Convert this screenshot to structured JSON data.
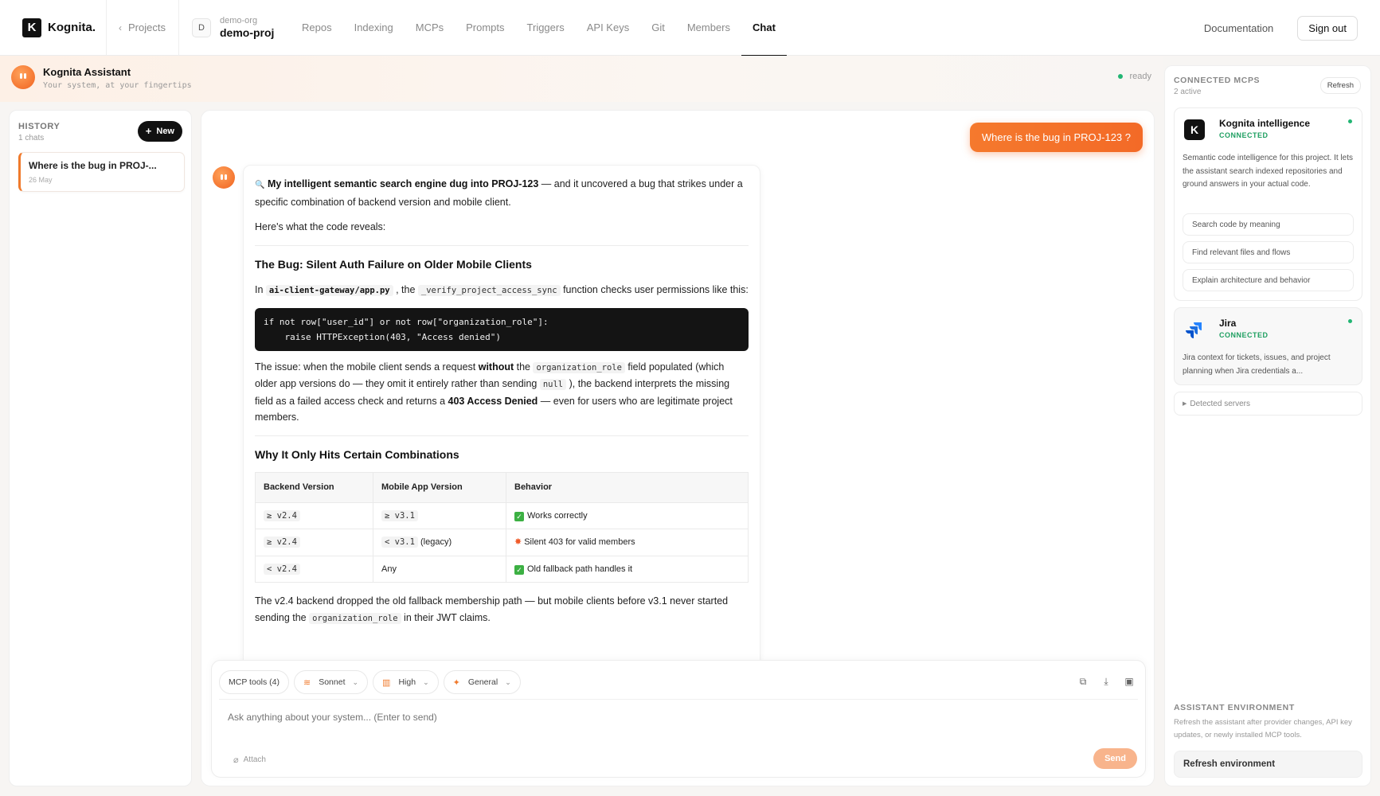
{
  "app": {
    "logo_letter": "K",
    "brand": "Kognita."
  },
  "nav": {
    "back_label": "Projects",
    "org_initial": "D",
    "org_name": "demo-org",
    "project_name": "demo-proj",
    "tabs": [
      {
        "label": "Repos",
        "active": false
      },
      {
        "label": "Indexing",
        "active": false
      },
      {
        "label": "MCPs",
        "active": false
      },
      {
        "label": "Prompts",
        "active": false
      },
      {
        "label": "Triggers",
        "active": false
      },
      {
        "label": "API Keys",
        "active": false
      },
      {
        "label": "Git",
        "active": false
      },
      {
        "label": "Members",
        "active": false
      },
      {
        "label": "Chat",
        "active": true
      }
    ],
    "documentation": "Documentation",
    "sign_out": "Sign out"
  },
  "assistant": {
    "title": "Kognita Assistant",
    "subtitle": "Your system, at your fingertips",
    "status": "ready"
  },
  "history": {
    "title": "HISTORY",
    "count": "1 chats",
    "new_label": "New",
    "items": [
      {
        "title": "Where is the bug in PROJ-...",
        "date": "26 May"
      }
    ]
  },
  "chat": {
    "user_message": "Where is the bug in PROJ-123 ?",
    "bot": {
      "intro_icon": "🔍",
      "intro_bold": "My intelligent semantic search engine dug into PROJ-123",
      "intro_rest": " — and it uncovered a bug that strikes under a specific combination of backend version and mobile client.",
      "reveals": "Here's what the code reveals:",
      "h1": "The Bug: Silent Auth Failure on Older Mobile Clients",
      "p1_a": "In ",
      "p1_file": "ai-client-gateway/app.py",
      "p1_b": " , the ",
      "p1_fn": "_verify_project_access_sync",
      "p1_c": " function checks user permissions like this:",
      "code": "if not row[\"user_id\"] or not row[\"organization_role\"]:\n    raise HTTPException(403, \"Access denied\")",
      "p2_a": "The issue: when the mobile client sends a request ",
      "p2_bold": "without",
      "p2_b": " the ",
      "p2_code": "organization_role",
      "p2_c": " field populated (which older app versions do — they omit it entirely rather than sending ",
      "p2_null": "null",
      "p2_d": " ), the backend interprets the missing field as a failed access check and returns a ",
      "p2_bold2": "403 Access Denied",
      "p2_e": " — even for users who are legitimate project members.",
      "h2": "Why It Only Hits Certain Combinations",
      "table_headers": [
        "Backend Version",
        "Mobile App Version",
        "Behavior"
      ],
      "table_rows": [
        {
          "backend": "≥ v2.4",
          "mobile": "≥ v3.1",
          "mobile_note": "",
          "icon": "✅",
          "behavior": "Works correctly"
        },
        {
          "backend": "≥ v2.4",
          "mobile": "< v3.1",
          "mobile_note": " (legacy)",
          "icon": "💥",
          "behavior": "Silent 403 for valid members"
        },
        {
          "backend": "< v2.4",
          "mobile": "",
          "mobile_note": "Any",
          "icon": "✅",
          "behavior": "Old fallback path handles it"
        }
      ],
      "p3_a": "The v2.4 backend dropped the old fallback membership path — but mobile clients before v3.1 never started sending the ",
      "p3_code": "organization_role",
      "p3_b": " in their JWT claims."
    }
  },
  "composer": {
    "mcp_tools": "MCP tools (4)",
    "model": "Sonnet",
    "effort": "High",
    "mode": "General",
    "placeholder": "Ask anything about your system... (Enter to send)",
    "attach": "Attach",
    "send": "Send",
    "icons": [
      "copy-icon",
      "download-icon",
      "image-icon"
    ]
  },
  "mcps": {
    "title": "CONNECTED MCPS",
    "count": "2 active",
    "refresh": "Refresh",
    "kognita": {
      "logo": "K",
      "name": "Kognita intelligence",
      "status": "CONNECTED",
      "desc": "Semantic code intelligence for this project. It lets the assistant search indexed repositories and ground answers in your actual code.",
      "capabilities": [
        "Search code by meaning",
        "Find relevant files and flows",
        "Explain architecture and behavior"
      ]
    },
    "jira": {
      "name": "Jira",
      "status": "CONNECTED",
      "desc": "Jira context for tickets, issues, and project planning when Jira credentials a..."
    },
    "detected": "Detected servers"
  },
  "environment": {
    "title": "ASSISTANT ENVIRONMENT",
    "desc": "Refresh the assistant after provider changes, API key updates, or newly installed MCP tools.",
    "button": "Refresh environment"
  },
  "colors": {
    "accent": "#f36a27",
    "connected": "#1e9f61",
    "jira_blue": "#2684ff"
  }
}
